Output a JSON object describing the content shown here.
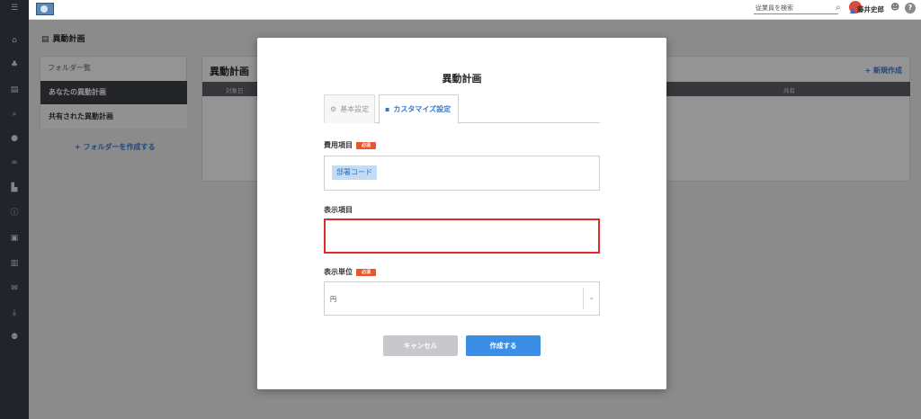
{
  "topbar": {
    "search_placeholder": "従業員を検索",
    "user_name": "藤井史郎",
    "help_label": "?"
  },
  "sidebar": {
    "icons": [
      "menu-icon",
      "home-icon",
      "org-chart-icon",
      "document-icon",
      "search-icon",
      "chat-icon",
      "link-icon",
      "chart-icon",
      "info-icon",
      "contact-icon",
      "book-icon",
      "mail-icon",
      "download-icon",
      "user-settings-icon"
    ]
  },
  "page": {
    "title": "異動計画"
  },
  "folders": {
    "title": "フォルダ一覧",
    "items": [
      "あなたの異動計画",
      "共有された異動計画"
    ],
    "add_label": "+ フォルダーを作成する"
  },
  "main": {
    "title": "異動計画",
    "new_label": "+ 新規作成",
    "columns": [
      "対象日",
      "共有"
    ]
  },
  "modal": {
    "title": "異動計画",
    "tabs": [
      {
        "label": "基本設定",
        "icon": "gear-icon"
      },
      {
        "label": "カスタマイズ設定",
        "icon": "lock-icon"
      }
    ],
    "required_label": "必須",
    "cost_field": {
      "label": "費用項目",
      "tag": "部署コード"
    },
    "display_field": {
      "label": "表示項目",
      "value": ""
    },
    "unit_field": {
      "label": "表示単位",
      "value": "円"
    },
    "cancel_label": "キャンセル",
    "create_label": "作成する"
  },
  "colors": {
    "accent": "#3a8ee6",
    "error": "#e02a2a",
    "required": "#e8562e",
    "sidebar": "#2b2d33"
  }
}
